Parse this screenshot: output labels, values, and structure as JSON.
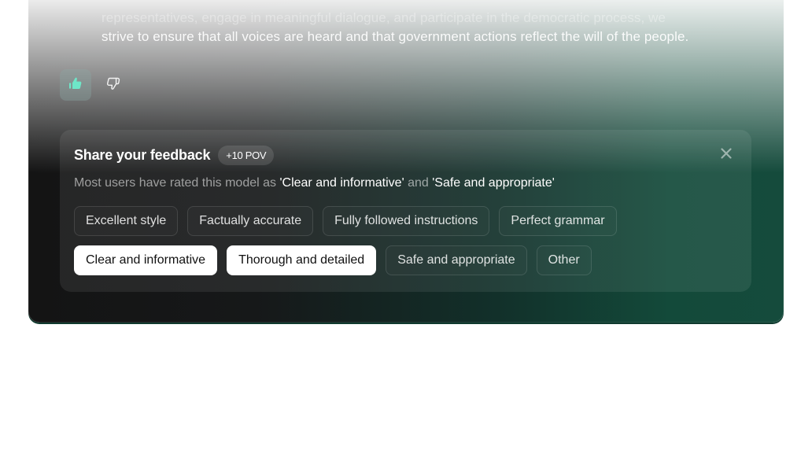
{
  "message": {
    "faded_line": "representatives, engage in meaningful dialogue, and participate in the democratic process, we",
    "last_line": "strive to ensure that all voices are heard and that government actions reflect the will of the people."
  },
  "rating": {
    "thumbs_up": {
      "icon": "thumbs-up-icon",
      "active": true
    },
    "thumbs_down": {
      "icon": "thumbs-down-icon",
      "active": false
    }
  },
  "feedback": {
    "title": "Share your feedback",
    "badge": "+10 POV",
    "close_icon": "close-icon",
    "subtitle_prefix": "Most users have rated this model as ",
    "subtitle_hl1": "'Clear and informative'",
    "subtitle_mid": " and ",
    "subtitle_hl2": "'Safe and appropriate'",
    "rows": [
      [
        {
          "label": "Excellent style",
          "selected": false
        },
        {
          "label": "Factually accurate",
          "selected": false
        },
        {
          "label": "Fully followed instructions",
          "selected": false
        },
        {
          "label": "Perfect grammar",
          "selected": false
        }
      ],
      [
        {
          "label": "Clear and informative",
          "selected": true
        },
        {
          "label": "Thorough and detailed",
          "selected": true
        },
        {
          "label": "Safe and appropriate",
          "selected": false
        },
        {
          "label": "Other",
          "selected": false
        }
      ]
    ]
  },
  "colors": {
    "accent": "#6ee7c8",
    "card_green": "#134a3a",
    "card_dark": "#141414",
    "chip_selected_bg": "#ffffff"
  }
}
